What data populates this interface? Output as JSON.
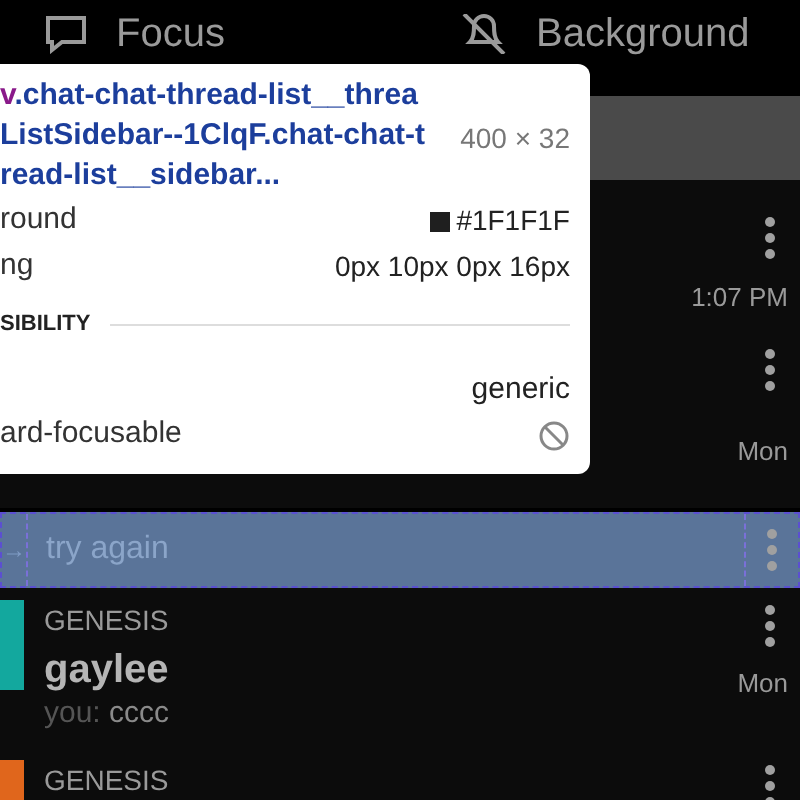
{
  "tabs": [
    {
      "label": "Focus"
    },
    {
      "label": "Background"
    }
  ],
  "inspector": {
    "tag": "v",
    "selector": [
      ".chat-chat-thread-list__threa",
      "ListSidebar--1ClqF.chat-chat-t",
      "read-list__sidebar..."
    ],
    "size": "400 × 32",
    "properties": [
      {
        "label": "round",
        "value": "#1F1F1F",
        "kind": "color"
      },
      {
        "label": "ng",
        "value": "0px 10px 0px 16px",
        "kind": "text"
      }
    ],
    "section": "SIBILITY",
    "accessibility": [
      {
        "value": "generic",
        "kind": "text"
      },
      {
        "label": "ard-focusable",
        "kind": "blocked"
      }
    ]
  },
  "threads": [
    {
      "kind": "plain",
      "time": "1:07 PM"
    },
    {
      "kind": "plain",
      "time": "Mon"
    },
    {
      "kind": "highlight",
      "marker": "→",
      "preview": "try again"
    },
    {
      "kind": "thread",
      "group": "GENESIS",
      "name": "gaylee",
      "sender": "you:",
      "preview": "cccc",
      "time": "Mon",
      "color": "#13a89e"
    },
    {
      "kind": "thread",
      "group": "GENESIS",
      "color": "#e0661c"
    }
  ]
}
